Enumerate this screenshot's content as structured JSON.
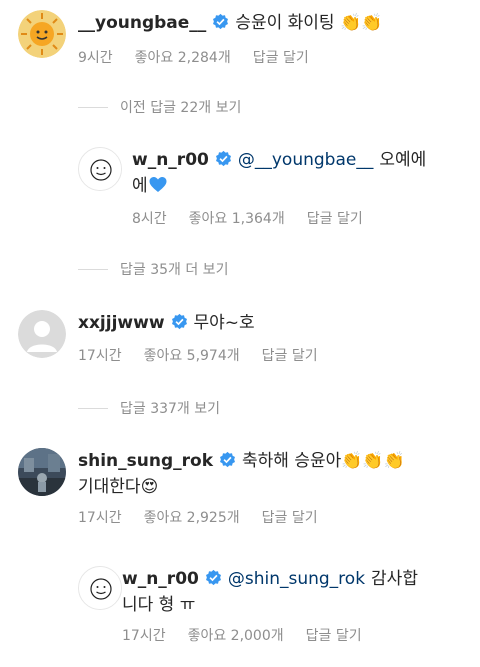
{
  "comments": [
    {
      "username": "__youngbae__",
      "text": "승윤이 화이팅",
      "emojis": "👏👏",
      "time": "9시간",
      "likes": "좋아요 2,284개",
      "reply": "답글 달기"
    },
    {
      "username": "w_n_r00",
      "mention": "@__youngbae__",
      "text_line1": "오예에",
      "text_line2": "에",
      "time": "8시간",
      "likes": "좋아요 1,364개",
      "reply": "답글 달기"
    },
    {
      "username": "xxjjjwww",
      "text": "무야~호",
      "time": "17시간",
      "likes": "좋아요 5,974개",
      "reply": "답글 달기"
    },
    {
      "username": "shin_sung_rok",
      "text": "축하해 승윤아",
      "emojis": "👏👏👏",
      "text_line2": "기대한다",
      "emoji2": "😍",
      "time": "17시간",
      "likes": "좋아요 2,925개",
      "reply": "답글 달기"
    },
    {
      "username": "w_n_r00",
      "mention": "@shin_sung_rok",
      "text_line1": "감사합",
      "text_line2": "니다 형 ㅠ",
      "time": "17시간",
      "likes": "좋아요 2,000개",
      "reply": "답글 달기"
    }
  ],
  "threads": {
    "prev_replies": "이전 답글 22개 보기",
    "more_replies": "답글 35개 더 보기",
    "view_replies": "답글 337개 보기"
  },
  "colors": {
    "verified": "#3897f0",
    "mention": "#00376b",
    "meta": "#8e8e8e",
    "heart": "#3897f0"
  },
  "icons": [
    "sun-avatar",
    "smiley-avatar",
    "default-avatar",
    "photo-avatar",
    "verified-badge-icon",
    "clap-emoji",
    "heart-eyes-emoji",
    "blue-heart-emoji"
  ]
}
